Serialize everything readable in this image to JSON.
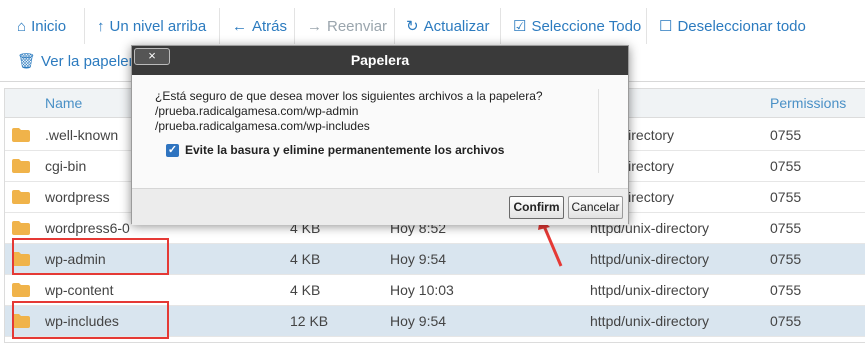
{
  "toolbar": {
    "row1": [
      {
        "icon": "home-icon",
        "glyph": "⌂",
        "label": "Inicio",
        "disabled": false
      },
      {
        "icon": "arrow-up-icon",
        "glyph": "↑",
        "label": "Un nivel arriba",
        "disabled": false
      },
      {
        "icon": "arrow-left-icon",
        "glyph": "←",
        "label": "Atrás",
        "disabled": false
      },
      {
        "icon": "arrow-right-icon",
        "glyph": "→",
        "label": "Reenviar",
        "disabled": true
      },
      {
        "icon": "refresh-icon",
        "glyph": "↻",
        "label": "Actualizar",
        "disabled": false
      },
      {
        "icon": "checkbox-checked-icon",
        "glyph": "☑",
        "label": "Seleccione Todo",
        "disabled": false
      },
      {
        "icon": "checkbox-empty-icon",
        "glyph": "☐",
        "label": "Deseleccionar todo",
        "disabled": false
      }
    ],
    "row2": [
      {
        "icon": "trash-icon",
        "glyph": "🗑",
        "label": "Ver la papelera",
        "disabled": false
      }
    ]
  },
  "table": {
    "headers": {
      "name": "Name",
      "permissions": "Permissions"
    },
    "rows": [
      {
        "name": ".well-known",
        "size": "",
        "date": "",
        "type": "unix-directory",
        "perm": "0755",
        "selected": false
      },
      {
        "name": "cgi-bin",
        "size": "",
        "date": "",
        "type": "unix-directory",
        "perm": "0755",
        "selected": false
      },
      {
        "name": "wordpress",
        "size": "",
        "date": "",
        "type": "unix-directory",
        "perm": "0755",
        "selected": false
      },
      {
        "name": "wordpress6-0",
        "size": "4 KB",
        "date": "Hoy 8:52",
        "type": "httpd/unix-directory",
        "perm": "0755",
        "selected": false
      },
      {
        "name": "wp-admin",
        "size": "4 KB",
        "date": "Hoy 9:54",
        "type": "httpd/unix-directory",
        "perm": "0755",
        "selected": true
      },
      {
        "name": "wp-content",
        "size": "4 KB",
        "date": "Hoy 10:03",
        "type": "httpd/unix-directory",
        "perm": "0755",
        "selected": false
      },
      {
        "name": "wp-includes",
        "size": "12 KB",
        "date": "Hoy 9:54",
        "type": "httpd/unix-directory",
        "perm": "0755",
        "selected": true
      }
    ]
  },
  "dialog": {
    "title": "Papelera",
    "close_label": "×",
    "message": "¿Está seguro de que desea mover los siguientes archivos a la papelera?",
    "files": [
      "/prueba.radicalgamesa.com/wp-admin",
      "/prueba.radicalgamesa.com/wp-includes"
    ],
    "checkbox_label": "Evite la basura y elimine permanentemente los archivos",
    "checkbox_checked": true,
    "confirm_label": "Confirm",
    "cancel_label": "Cancelar"
  },
  "colors": {
    "accent": "#2c7bbf",
    "highlight": "#e53935",
    "selected_row": "#d9e5ef",
    "folder": "#f0b34a"
  }
}
